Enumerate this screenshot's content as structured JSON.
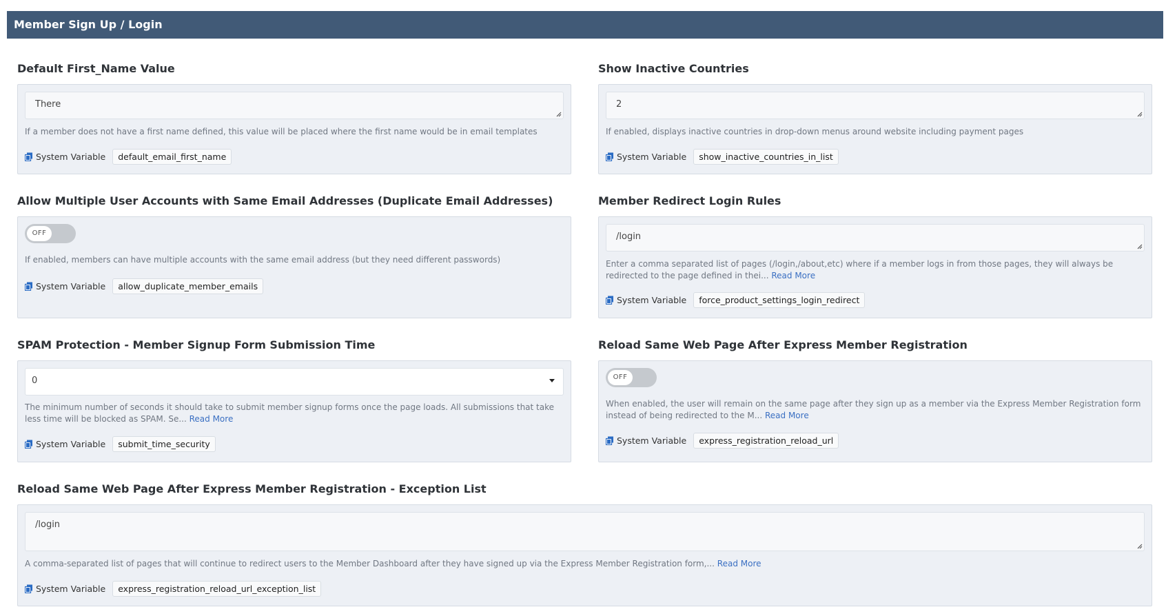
{
  "header": {
    "title": "Member Sign Up / Login"
  },
  "settings": {
    "first_name": {
      "label": "Default First_Name Value",
      "value": "There",
      "help": "If a member does not have a first name defined, this value will be placed where the first name would be in email templates",
      "sys_label": "System Variable",
      "sys_var": "default_email_first_name"
    },
    "inactive_countries": {
      "label": "Show Inactive Countries",
      "value": "2",
      "help": "If enabled, displays inactive countries in drop-down menus around website including payment pages",
      "sys_label": "System Variable",
      "sys_var": "show_inactive_countries_in_list"
    },
    "duplicate_emails": {
      "label": "Allow Multiple User Accounts with Same Email Addresses (Duplicate Email Addresses)",
      "toggle": "OFF",
      "help": "If enabled, members can have multiple accounts with the same email address (but they need different passwords)",
      "sys_label": "System Variable",
      "sys_var": "allow_duplicate_member_emails"
    },
    "redirect_rules": {
      "label": "Member Redirect Login Rules",
      "value": "/login",
      "help": "Enter a comma separated list of pages (/login,/about,etc) where if a member logs in from those pages, they will always be redirected to the page defined in thei...",
      "read_more": "Read More",
      "sys_label": "System Variable",
      "sys_var": "force_product_settings_login_redirect"
    },
    "spam_protection": {
      "label": "SPAM Protection - Member Signup Form Submission Time",
      "value": "0",
      "help": "The minimum number of seconds it should take to submit member signup forms once the page loads.  All submissions that take less time will be blocked as SPAM. Se...",
      "read_more": "Read More",
      "sys_label": "System Variable",
      "sys_var": "submit_time_security"
    },
    "reload_page": {
      "label": "Reload Same Web Page After Express Member Registration",
      "toggle": "OFF",
      "help": "When enabled, the user will remain on the same page after they sign up as a member via the Express Member Registration form instead of being redirected to the M...",
      "read_more": "Read More",
      "sys_label": "System Variable",
      "sys_var": "express_registration_reload_url"
    },
    "exception_list": {
      "label": "Reload Same Web Page After Express Member Registration - Exception List",
      "value": "/login",
      "help": "A comma-separated list of pages that will continue to redirect users to the Member Dashboard after they have signed up via the Express Member Registration form,...",
      "read_more": "Read More",
      "sys_label": "System Variable",
      "sys_var": "express_registration_reload_url_exception_list"
    }
  },
  "colors": {
    "header_bg": "#415a77",
    "card_bg": "#edf0f5",
    "link": "#3a6fc2",
    "icon": "#2b6cc4"
  },
  "icons": {
    "copy": "copy-icon",
    "resize": "resize-handle-icon",
    "caret": "caret-down-icon"
  }
}
